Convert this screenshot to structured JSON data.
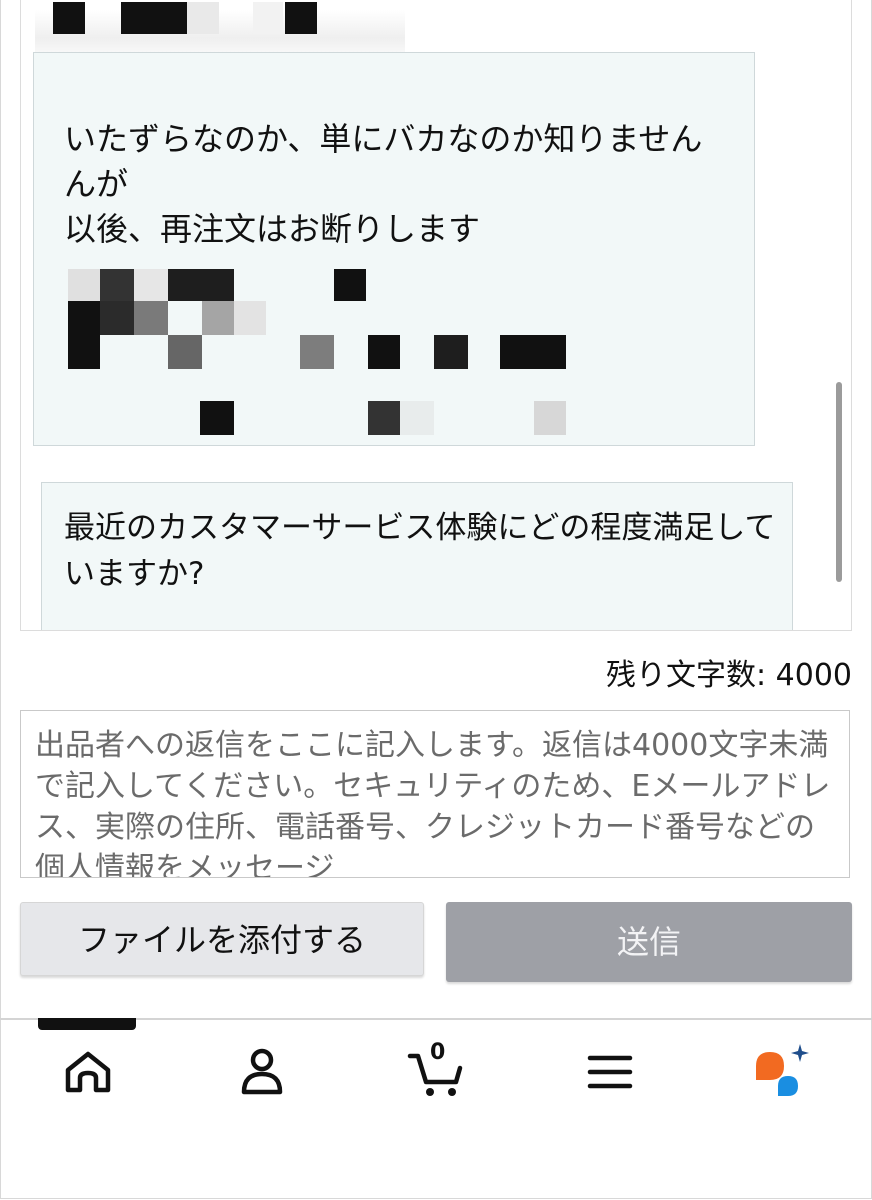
{
  "thread": {
    "message_text": "いたずらなのか、単にバカなのか知りません\nんが\n以後、再注文はお断りします",
    "survey_text": "最近のカスタマーサービス体験にどの程度満足していますか?"
  },
  "composer": {
    "char_count_label": "残り文字数: 4000",
    "placeholder": "出品者への返信をここに記入します。返信は4000文字未満で記入してください。セキュリティのため、Eメールアドレス、実際の住所、電話番号、クレジットカード番号などの個人情報をメッセージ",
    "attach_label": "ファイルを添付する",
    "send_label": "送信"
  },
  "bottom_nav": {
    "items": [
      "home-icon",
      "account-icon",
      "cart-icon",
      "menu-icon",
      "assistant-icon"
    ],
    "cart_count": "0",
    "colors": {
      "assistant_orange": "#f26a21",
      "assistant_blue": "#1a8ee1",
      "assistant_spark": "#1f4e8c"
    }
  },
  "colors": {
    "bubble_bg": "#f2f8f8",
    "send_button_bg": "#9ea0a6",
    "attach_button_bg": "#e6e7ea"
  }
}
